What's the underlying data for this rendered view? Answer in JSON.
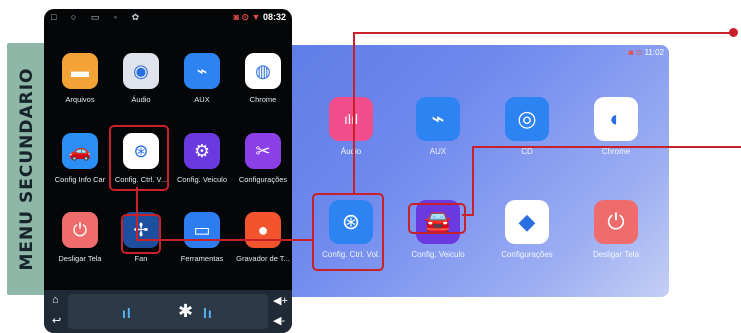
{
  "side_label": "MENU SECUNDARIO",
  "phone": {
    "status": {
      "left": "□ ○ ▭  ◦ ✿",
      "time": "08:32",
      "icons": "◙ ⊙ ▼"
    },
    "apps": [
      {
        "label": "Arquivos",
        "icon": "folder-icon",
        "color": "#f3a237",
        "glyph": "▬"
      },
      {
        "label": "Áudio",
        "icon": "audio-knob-icon",
        "color": "#dfe3ec",
        "glyph": "◉"
      },
      {
        "label": "AUX",
        "icon": "aux-cable-icon",
        "color": "#2d83f2",
        "glyph": "⌁"
      },
      {
        "label": "Chrome",
        "icon": "chrome-icon",
        "color": "#ffffff",
        "glyph": "◍"
      },
      {
        "label": "Config Info Car",
        "icon": "car-info-icon",
        "color": "#2a8ef5",
        "glyph": "🚗"
      },
      {
        "label": "Config. Ctrl. V...",
        "icon": "steering-wheel-icon",
        "color": "#ffffff",
        "glyph": "⊛"
      },
      {
        "label": "Config. Veiculo",
        "icon": "vehicle-config-icon",
        "color": "#6b39e0",
        "glyph": "⚙"
      },
      {
        "label": "Configurações",
        "icon": "tools-icon",
        "color": "#8b3fe6",
        "glyph": "✂"
      },
      {
        "label": "Desligar Tela",
        "icon": "power-icon",
        "color": "#f06b6b",
        "glyph": "⏻"
      },
      {
        "label": "Fan",
        "icon": "fan-icon",
        "color": "#1e4f9e",
        "glyph": "✢"
      },
      {
        "label": "Ferramentas",
        "icon": "toolbox-icon",
        "color": "#2e7df0",
        "glyph": "▭"
      },
      {
        "label": "Gravador de T...",
        "icon": "recorder-icon",
        "color": "#f2542d",
        "glyph": "●"
      }
    ],
    "dock": {
      "home": "⌂",
      "back": "↩",
      "eq_left": "ıl",
      "eq_right": "lı",
      "bt": "✱",
      "vol_up": "◀+",
      "vol_down": "◀-"
    }
  },
  "screen": {
    "status": {
      "time": "11:02",
      "icons": "◙ ⊙",
      "left": "▯  ▪"
    },
    "apps": [
      {
        "label": "Áudio",
        "icon": "audio-wave-icon",
        "color": "#f04d8a",
        "glyph": "ılıl"
      },
      {
        "label": "AUX",
        "icon": "aux-cable-icon",
        "color": "#2d83f2",
        "glyph": "⌁"
      },
      {
        "label": "CD",
        "icon": "cd-icon",
        "color": "#2d83f2",
        "glyph": "◎"
      },
      {
        "label": "Chrome",
        "icon": "chrome-icon",
        "color": "#ffffff",
        "glyph": "◐"
      },
      {
        "label": "Config. Ctrl. Vol.",
        "icon": "steering-wheel-icon",
        "color": "#2d83f2",
        "glyph": "⊛"
      },
      {
        "label": "Config. Veiculo",
        "icon": "vehicle-config-icon",
        "color": "#6b39e0",
        "glyph": "🚘"
      },
      {
        "label": "Configurações",
        "icon": "settings-icon",
        "color": "#ffffff",
        "glyph": "◆"
      },
      {
        "label": "Desligar Tela",
        "icon": "power-icon",
        "color": "#f06b6b",
        "glyph": "⏻"
      }
    ]
  },
  "colors": {
    "highlight": "#c8212a",
    "side_label_bg": "#8fb7a8"
  }
}
